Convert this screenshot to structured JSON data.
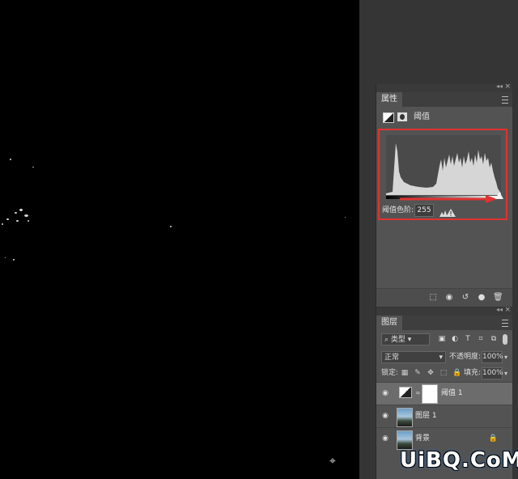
{
  "canvas": {
    "cursor_icon": "crosshair-cursor-icon"
  },
  "properties_panel": {
    "tab_label": "属性",
    "adjustment_name": "阈值",
    "threshold_label": "阈值色阶:",
    "threshold_value": "255",
    "highlight_color": "#e13232",
    "bottom_icons": [
      "clip-to-layer-icon",
      "view-previous-icon",
      "reset-icon",
      "visibility-icon",
      "delete-icon"
    ]
  },
  "layers_panel": {
    "tab_label": "图层",
    "filter_kind": "类型",
    "blend_mode": "正常",
    "opacity_label": "不透明度:",
    "opacity_value": "100%",
    "lock_label": "锁定:",
    "fill_label": "填充:",
    "fill_value": "100%",
    "layers": [
      {
        "name": "阈值 1",
        "type": "adjustment",
        "selected": true
      },
      {
        "name": "图层 1",
        "type": "pixel",
        "selected": false
      },
      {
        "name": "背景",
        "type": "background",
        "selected": false,
        "locked": true
      }
    ]
  },
  "watermark": {
    "text_main": "UiBQ.CoM",
    "accent": "#1d73d1"
  }
}
